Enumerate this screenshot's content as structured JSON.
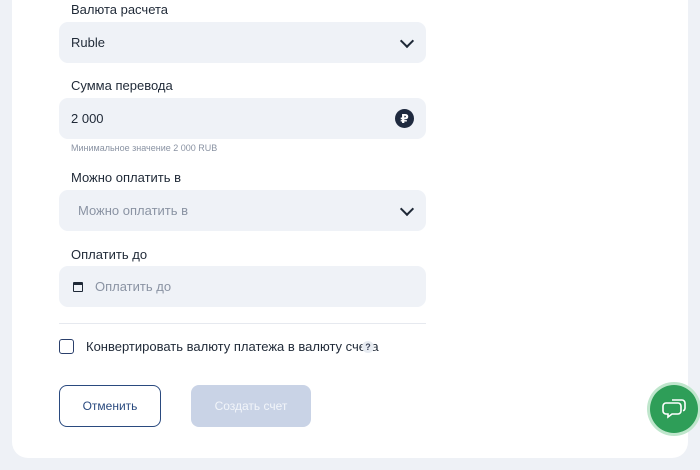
{
  "form": {
    "currency": {
      "label": "Валюта расчета",
      "value": "Ruble"
    },
    "amount": {
      "label": "Сумма перевода",
      "value": "2 000",
      "currency_symbol": "₽",
      "hint": "Минимальное значение 2 000 RUB"
    },
    "pay_in": {
      "label": "Можно оплатить в",
      "placeholder": "Можно оплатить в"
    },
    "pay_until": {
      "label": "Оплатить до",
      "placeholder": "Оплатить до"
    },
    "convert": {
      "label": "Конвертировать валюту платежа в валюту счета",
      "checked": false,
      "help": "?"
    }
  },
  "actions": {
    "cancel_label": "Отменить",
    "create_label": "Создать счет"
  },
  "colors": {
    "accent": "#2a4a7f",
    "field_bg": "#eff2f7",
    "disabled_button": "#c9d3e6",
    "chat_button": "#2e9e58"
  },
  "icons": {
    "select_arrow": "chevron-down-icon",
    "currency": "ruble-icon",
    "date": "calendar-icon",
    "help": "help-icon",
    "chat": "chat-icon"
  }
}
